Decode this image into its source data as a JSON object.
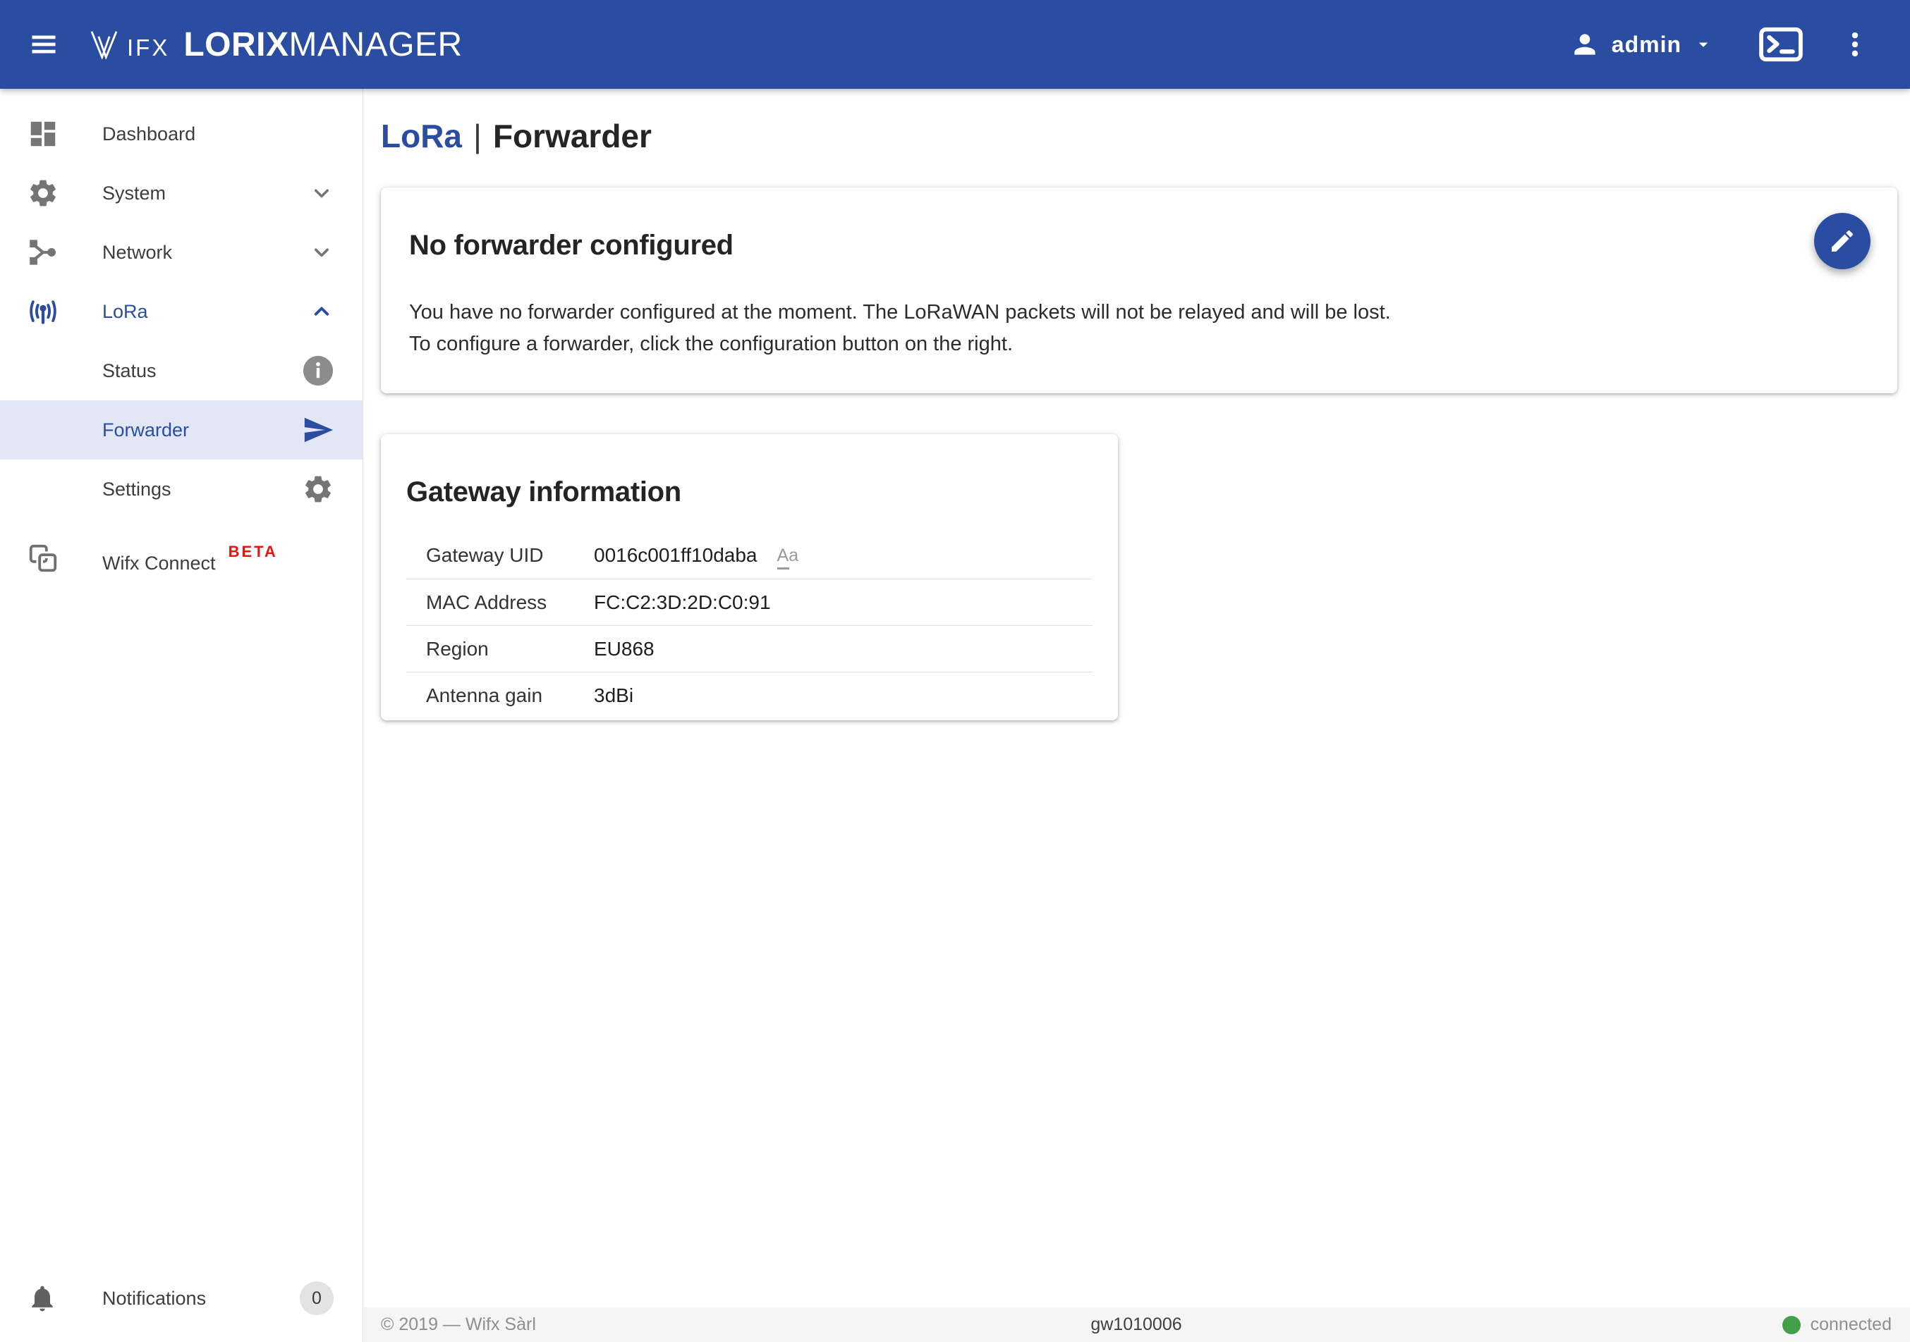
{
  "colors": {
    "brand_blue": "#2b4da1",
    "selected_row_bg": "#e3e7f5",
    "beta_red": "#ea1313",
    "connected_green": "#43a047",
    "footer_bg": "#f5f5f5"
  },
  "header": {
    "brand": {
      "ifx": "IFX",
      "product_bold": "LORIX",
      "product_light": "MANAGER"
    },
    "user": {
      "name": "admin"
    }
  },
  "sidebar": {
    "items": [
      {
        "label": "Dashboard"
      },
      {
        "label": "System"
      },
      {
        "label": "Network"
      },
      {
        "label": "LoRa"
      },
      {
        "label": "Status"
      },
      {
        "label": "Forwarder"
      },
      {
        "label": "Settings"
      },
      {
        "label": "Wifx Connect",
        "badge": "BETA"
      }
    ],
    "notifications": {
      "label": "Notifications",
      "count": "0"
    }
  },
  "page": {
    "section": "LoRa",
    "separator": "|",
    "title": "Forwarder"
  },
  "cards": {
    "forwarder": {
      "title": "No forwarder configured",
      "line1": "You have no forwarder configured at the moment. The LoRaWAN packets will not be relayed and will be lost.",
      "line2": "To configure a forwarder, click the configuration button on the right."
    },
    "gateway": {
      "title": "Gateway information",
      "rows": [
        {
          "label": "Gateway UID",
          "value": "0016c001ff10daba",
          "case_toggle": "Aa"
        },
        {
          "label": "MAC Address",
          "value": "FC:C2:3D:2D:C0:91"
        },
        {
          "label": "Region",
          "value": "EU868"
        },
        {
          "label": "Antenna gain",
          "value": "3dBi"
        }
      ]
    }
  },
  "footer": {
    "copyright": "© 2019 — Wifx Sàrl",
    "gateway_id": "gw1010006",
    "status": "connected"
  }
}
